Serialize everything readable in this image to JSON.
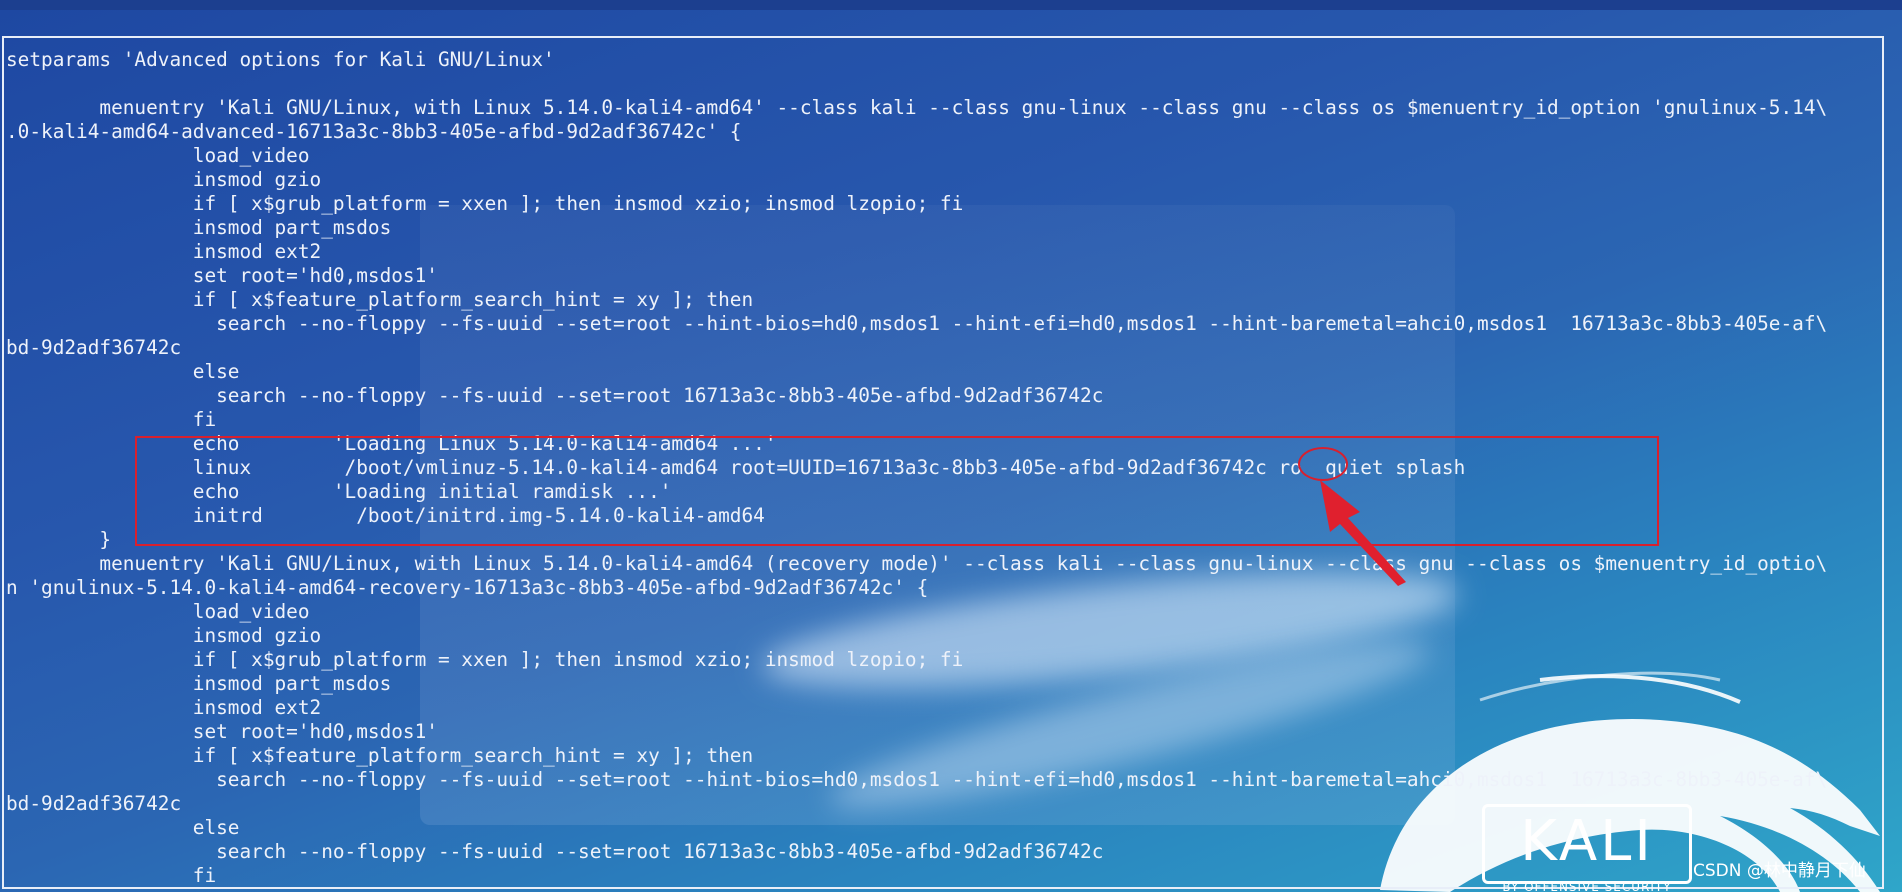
{
  "terminal": {
    "lines": [
      "setparams 'Advanced options for Kali GNU/Linux'",
      "",
      "        menuentry 'Kali GNU/Linux, with Linux 5.14.0-kali4-amd64' --class kali --class gnu-linux --class gnu --class os $menuentry_id_option 'gnulinux-5.14\\",
      ".0-kali4-amd64-advanced-16713a3c-8bb3-405e-afbd-9d2adf36742c' {",
      "                load_video",
      "                insmod gzio",
      "                if [ x$grub_platform = xxen ]; then insmod xzio; insmod lzopio; fi",
      "                insmod part_msdos",
      "                insmod ext2",
      "                set root='hd0,msdos1'",
      "                if [ x$feature_platform_search_hint = xy ]; then",
      "                  search --no-floppy --fs-uuid --set=root --hint-bios=hd0,msdos1 --hint-efi=hd0,msdos1 --hint-baremetal=ahci0,msdos1  16713a3c-8bb3-405e-af\\",
      "bd-9d2adf36742c",
      "                else",
      "                  search --no-floppy --fs-uuid --set=root 16713a3c-8bb3-405e-afbd-9d2adf36742c",
      "                fi",
      "                echo        'Loading Linux 5.14.0-kali4-amd64 ...'",
      "                linux        /boot/vmlinuz-5.14.0-kali4-amd64 root=UUID=16713a3c-8bb3-405e-afbd-9d2adf36742c ro  quiet splash",
      "                echo        'Loading initial ramdisk ...'",
      "                initrd        /boot/initrd.img-5.14.0-kali4-amd64",
      "        }",
      "        menuentry 'Kali GNU/Linux, with Linux 5.14.0-kali4-amd64 (recovery mode)' --class kali --class gnu-linux --class gnu --class os $menuentry_id_optio\\",
      "n 'gnulinux-5.14.0-kali4-amd64-recovery-16713a3c-8bb3-405e-afbd-9d2adf36742c' {",
      "                load_video",
      "                insmod gzio",
      "                if [ x$grub_platform = xxen ]; then insmod xzio; insmod lzopio; fi",
      "                insmod part_msdos",
      "                insmod ext2",
      "                set root='hd0,msdos1'",
      "                if [ x$feature_platform_search_hint = xy ]; then",
      "                  search --no-floppy --fs-uuid --set=root --hint-bios=hd0,msdos1 --hint-efi=hd0,msdos1 --hint-baremetal=ahci0,msdos1  16713a3c-8bb3-405e-af\\",
      "bd-9d2adf36742c",
      "                else",
      "                  search --no-floppy --fs-uuid --set=root 16713a3c-8bb3-405e-afbd-9d2adf36742c",
      "                fi"
    ]
  },
  "logo": {
    "brand": "KALI",
    "tagline": "BY OFFENSIVE SECURITY"
  },
  "watermark": "CSDN @林中静月下仙",
  "colors": {
    "annotation": "#d8202e",
    "text": "#eef2fa",
    "background": "#2757ad"
  }
}
